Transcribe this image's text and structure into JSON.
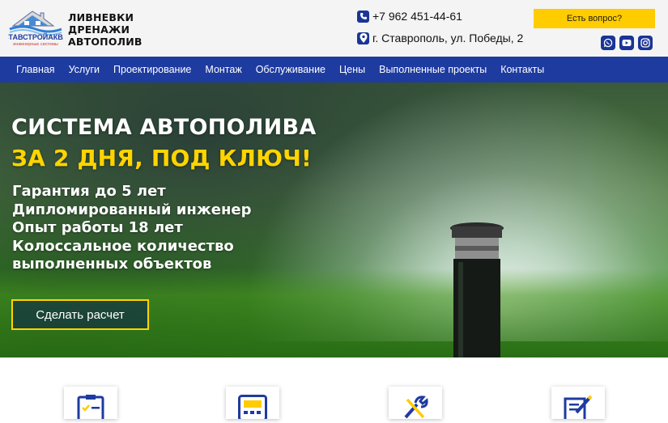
{
  "brand": {
    "logo_line1": "СТАВСТРОЙАКВА",
    "logo_line2": "инженерные системы",
    "tagline": [
      "ЛИВНЕВКИ",
      "ДРЕНАЖИ",
      "АВТОПОЛИВ"
    ]
  },
  "contacts": {
    "phone": "+7 962 451-44-61",
    "address": "г. Ставрополь, ул. Победы, 2",
    "ask_button": "Есть вопрос?",
    "socials": [
      "whatsapp-icon",
      "youtube-icon",
      "instagram-icon"
    ]
  },
  "nav": {
    "items": [
      "Главная",
      "Услуги",
      "Проектирование",
      "Монтаж",
      "Обслуживание",
      "Цены",
      "Выполненные проекты",
      "Контакты"
    ]
  },
  "hero": {
    "title": "СИСТЕМА АВТОПОЛИВА",
    "subtitle": "ЗА 2 ДНЯ, ПОД КЛЮЧ!",
    "features": [
      "Гарантия до 5 лет",
      "Дипломированный инженер",
      "Опыт работы 18 лет",
      "Колоссальное количество",
      "выполненных объектов"
    ],
    "cta": "Сделать расчет"
  },
  "cards": {
    "icons": [
      "checklist-icon",
      "calculator-icon",
      "tools-icon",
      "document-edit-icon"
    ]
  },
  "colors": {
    "nav_bg": "#1e3ba0",
    "accent_yellow": "#ffcc00",
    "header_bg": "#f4f4f4"
  }
}
